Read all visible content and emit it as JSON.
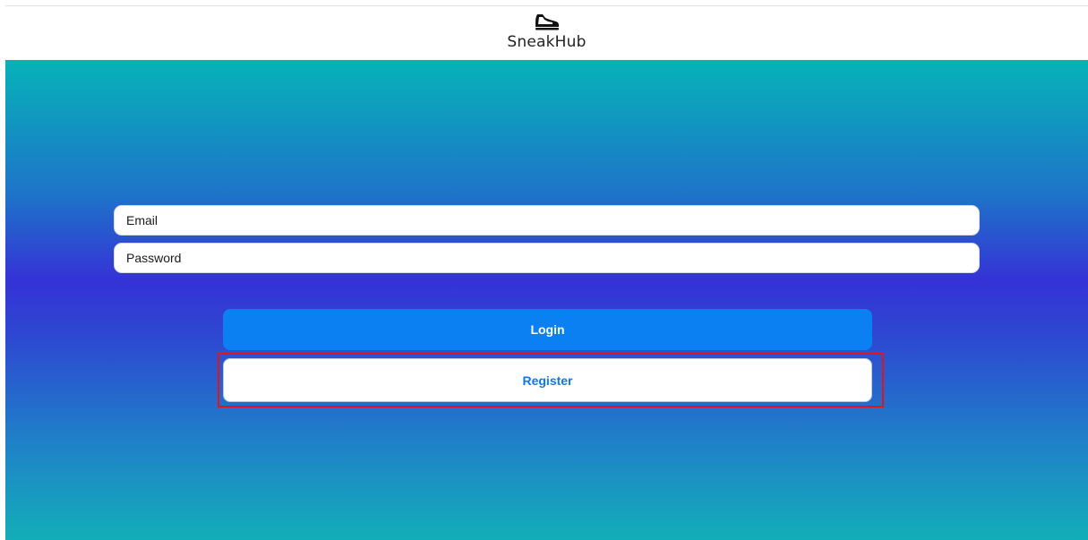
{
  "header": {
    "brand": "SneakHub",
    "logo_icon": "sneaker-icon"
  },
  "form": {
    "email_placeholder": "Email",
    "password_placeholder": "Password",
    "login_label": "Login",
    "register_label": "Register"
  },
  "colors": {
    "primary": "#0a80f2",
    "register_text": "#1277e6",
    "highlight": "#e1141c",
    "gradient_top": "#06b3b8",
    "gradient_mid": "#3532d6"
  }
}
